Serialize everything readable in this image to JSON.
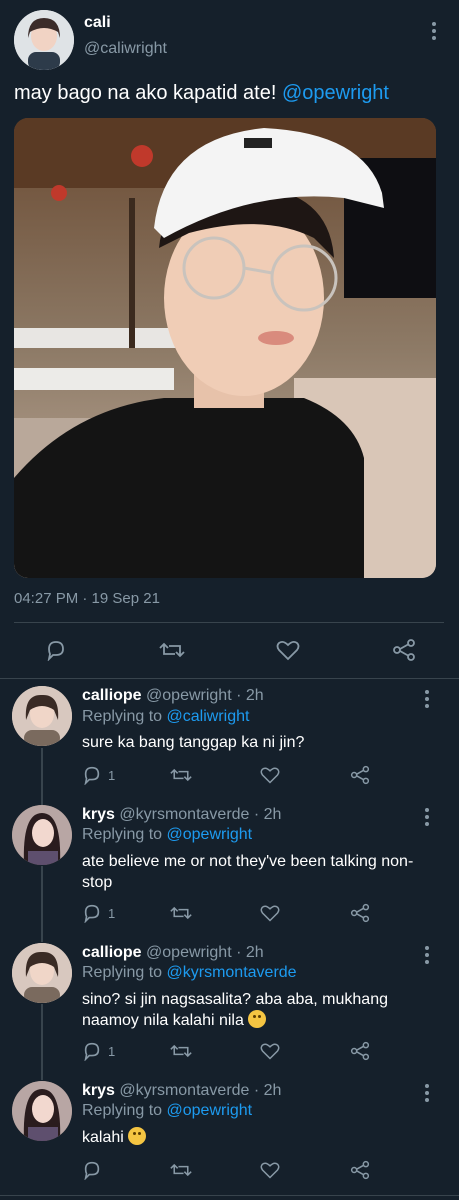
{
  "tweet": {
    "name": "cali",
    "handle": "@caliwright",
    "text": "may bago na ako kapatid ate! ",
    "mention": "@opewright",
    "timestamp": "04:27 PM · 19 Sep 21"
  },
  "replies": [
    {
      "name": "calliope",
      "meta": "@opewright · 2h",
      "replying_label": "Replying to ",
      "replying_to": "@caliwright",
      "text": "sure ka bang tanggap ka ni jin?",
      "reply_count": "1"
    },
    {
      "name": "krys",
      "meta": "@kyrsmontaverde · 2h",
      "replying_label": "Replying to ",
      "replying_to": "@opewright",
      "text": "ate believe me or not they've been talking non-stop",
      "reply_count": "1"
    },
    {
      "name": "calliope",
      "meta": "@opewright · 2h",
      "replying_label": "Replying to ",
      "replying_to": "@kyrsmontaverde",
      "text": "sino? si jin nagsasalita? aba aba, mukhang naamoy nila kalahi nila",
      "reply_count": "1"
    },
    {
      "name": "krys",
      "meta": "@kyrsmontaverde · 2h",
      "replying_label": "Replying to ",
      "replying_to": "@opewright",
      "text": "kalahi",
      "reply_count": ""
    }
  ],
  "colors": {
    "background": "#15202b",
    "accent": "#1d9bf0",
    "muted": "#8899a6",
    "divider": "#38444d"
  },
  "icons": [
    "reply-icon",
    "retweet-icon",
    "like-icon",
    "share-icon",
    "more-icon",
    "thinking-emoji",
    "laughing-emoji"
  ]
}
